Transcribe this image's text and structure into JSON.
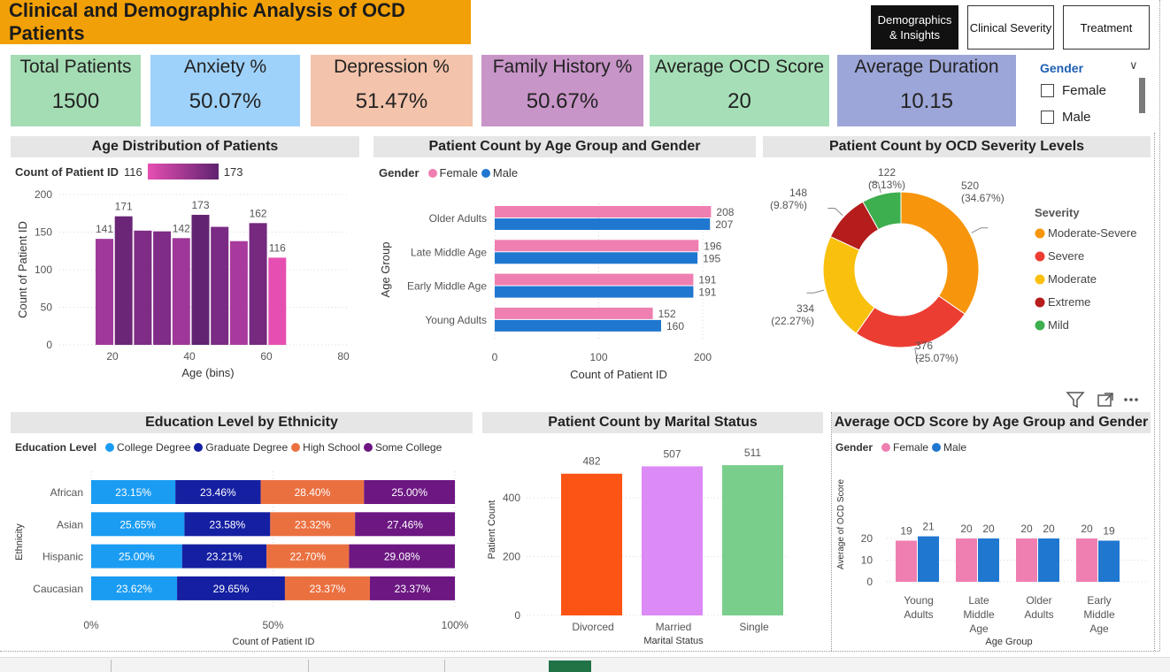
{
  "title": "Clinical and Demographic Analysis of OCD Patients",
  "nav": {
    "demographics": "Demographics & Insights",
    "clinical": "Clinical Severity",
    "treatment": "Treatment"
  },
  "cards": [
    {
      "label": "Total Patients",
      "value": "1500",
      "color": "#a4dcb4"
    },
    {
      "label": "Anxiety %",
      "value": "50.07%",
      "color": "#9fd2fb"
    },
    {
      "label": "Depression %",
      "value": "51.47%",
      "color": "#f4c3ab"
    },
    {
      "label": "Family History %",
      "value": "50.67%",
      "color": "#c895c8"
    },
    {
      "label": "Average OCD Score",
      "value": "20",
      "color": "#a6dfb7"
    },
    {
      "label": "Average Duration",
      "value": "10.15",
      "color": "#9da6d8"
    }
  ],
  "slicer": {
    "title": "Gender",
    "options": [
      "Female",
      "Male"
    ]
  },
  "age_dist": {
    "title": "Age Distribution of Patients",
    "legend_label": "Count of Patient ID",
    "legend_min": "116",
    "legend_max": "173",
    "xlabel": "Age (bins)",
    "ylabel": "Count of Patient ID",
    "yticks": [
      "0",
      "50",
      "100",
      "150",
      "200"
    ],
    "xticks": [
      "20",
      "40",
      "60",
      "80"
    ]
  },
  "age_gender": {
    "title": "Patient Count by Age Group and Gender",
    "legend_title": "Gender",
    "legend": [
      "Female",
      "Male"
    ],
    "xlabel": "Count of Patient ID",
    "ylabel": "Age Group",
    "xticks": [
      "0",
      "100",
      "200"
    ]
  },
  "severity": {
    "title": "Patient Count by OCD Severity Levels",
    "legend_title": "Severity",
    "legend": [
      "Moderate-Severe",
      "Severe",
      "Moderate",
      "Extreme",
      "Mild"
    ],
    "labels": [
      "520 (34.67%)",
      "376 (25.07%)",
      "334 (22.27%)",
      "148 (9.87%)",
      "122 (8.13%)"
    ]
  },
  "education": {
    "title": "Education Level by Ethnicity",
    "legend_title": "Education Level",
    "legend": [
      "College Degree",
      "Graduate Degree",
      "High School",
      "Some College"
    ],
    "xlabel": "Count of Patient ID",
    "ylabel": "Ethnicity",
    "xticks": [
      "0%",
      "50%",
      "100%"
    ]
  },
  "marital": {
    "title": "Patient Count by Marital Status",
    "xlabel": "Marital Status",
    "ylabel": "Patient Count",
    "yticks": [
      "0",
      "200",
      "400"
    ]
  },
  "avg_score": {
    "title": "Average OCD Score by Age Group and Gender",
    "legend_title": "Gender",
    "legend": [
      "Female",
      "Male"
    ],
    "xlabel": "Age Group",
    "ylabel": "Average of OCD Score",
    "yticks": [
      "0",
      "10",
      "20"
    ]
  },
  "chart_data": [
    {
      "type": "bar",
      "title": "Age Distribution of Patients",
      "xlabel": "Age (bins)",
      "ylabel": "Count of Patient ID",
      "x": [
        20,
        25,
        30,
        35,
        40,
        45,
        50,
        55,
        60,
        65,
        70
      ],
      "values": [
        141,
        171,
        152,
        151,
        142,
        173,
        157,
        138,
        162,
        116
      ],
      "data_labels": [
        141,
        171,
        null,
        null,
        142,
        173,
        null,
        null,
        162,
        116
      ],
      "ylim": [
        0,
        200
      ],
      "xlim": [
        15,
        80
      ],
      "colors": [
        "#a0389a",
        "#6b2677",
        "#7e2c86",
        "#7e2c86",
        "#9e3799",
        "#622373",
        "#7a2b84",
        "#a93a9d",
        "#75297f",
        "#e64fb2"
      ]
    },
    {
      "type": "bar",
      "orientation": "horizontal",
      "title": "Patient Count by Age Group and Gender",
      "categories": [
        "Older Adults",
        "Late Middle Age",
        "Early Middle Age",
        "Young Adults"
      ],
      "series": [
        {
          "name": "Female",
          "values": [
            208,
            196,
            191,
            152
          ],
          "color": "#ef7fb1"
        },
        {
          "name": "Male",
          "values": [
            207,
            195,
            191,
            160
          ],
          "color": "#1f77d0"
        }
      ],
      "xlim": [
        0,
        200
      ]
    },
    {
      "type": "pie",
      "donut": true,
      "title": "Patient Count by OCD Severity Levels",
      "categories": [
        "Moderate-Severe",
        "Severe",
        "Moderate",
        "Extreme",
        "Mild"
      ],
      "values": [
        520,
        376,
        334,
        148,
        122
      ],
      "percents": [
        34.67,
        25.07,
        22.27,
        9.87,
        8.13
      ],
      "colors": [
        "#f7950c",
        "#ec3d33",
        "#f9c10e",
        "#b51c1c",
        "#3daf4f"
      ]
    },
    {
      "type": "bar",
      "stacked": "100%",
      "orientation": "horizontal",
      "title": "Education Level by Ethnicity",
      "categories": [
        "African",
        "Asian",
        "Hispanic",
        "Caucasian"
      ],
      "series": [
        {
          "name": "College Degree",
          "values": [
            23.15,
            25.65,
            25.0,
            23.62
          ],
          "color": "#1a9cf3"
        },
        {
          "name": "Graduate Degree",
          "values": [
            23.46,
            23.58,
            23.21,
            29.65
          ],
          "color": "#141fa2"
        },
        {
          "name": "High School",
          "values": [
            28.4,
            23.32,
            22.7,
            23.37
          ],
          "color": "#eb7040"
        },
        {
          "name": "Some College",
          "values": [
            25.0,
            27.46,
            29.08,
            23.37
          ],
          "color": "#6c1782"
        }
      ]
    },
    {
      "type": "bar",
      "title": "Patient Count by Marital Status",
      "categories": [
        "Divorced",
        "Married",
        "Single"
      ],
      "values": [
        482,
        507,
        511
      ],
      "colors": [
        "#fc5414",
        "#dc8af6",
        "#7ace8c"
      ],
      "ylim": [
        0,
        520
      ]
    },
    {
      "type": "bar",
      "title": "Average OCD Score by Age Group and Gender",
      "categories": [
        "Young Adults",
        "Late Middle Age",
        "Older Adults",
        "Early Middle Age"
      ],
      "series": [
        {
          "name": "Female",
          "values": [
            19,
            20,
            20,
            20
          ],
          "color": "#ef7fb1"
        },
        {
          "name": "Male",
          "values": [
            21,
            20,
            20,
            19
          ],
          "color": "#1f77d0"
        }
      ],
      "ylim": [
        0,
        26
      ]
    }
  ]
}
